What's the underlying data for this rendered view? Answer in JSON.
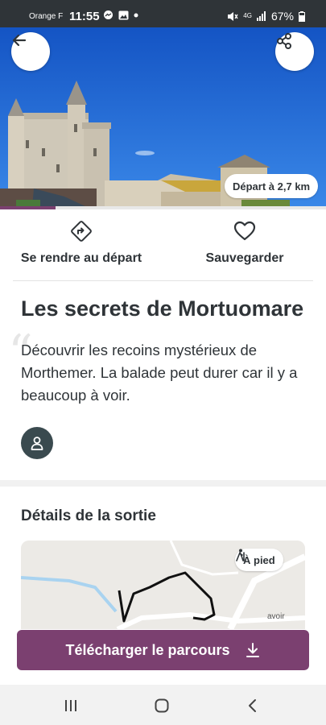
{
  "status_bar": {
    "carrier": "Orange F",
    "time": "11:55",
    "network": "4G",
    "battery": "67%"
  },
  "hero": {
    "distance_badge": "Départ à 2,7 km",
    "progress": 0.17
  },
  "actions": {
    "go_label": "Se rendre au départ",
    "save_label": "Sauvegarder"
  },
  "trail": {
    "title": "Les secrets de Mortuomare",
    "description": "Découvrir les recoins mystérieux de Morthemer. La balade peut durer car il y a beaucoup à voir."
  },
  "details": {
    "section_title": "Détails de la sortie",
    "mode_label": "À pied",
    "map_road_label": "avoir"
  },
  "download": {
    "label": "Télécharger le parcours"
  },
  "colors": {
    "accent": "#7b4070",
    "text": "#2f3438",
    "sky": "#1b64d9"
  },
  "icons": {
    "back": "arrow-left-icon",
    "share": "share-icon",
    "directions": "directions-icon",
    "save": "heart-icon",
    "avatar": "user-icon",
    "mode": "hiking-icon",
    "download": "download-icon"
  }
}
